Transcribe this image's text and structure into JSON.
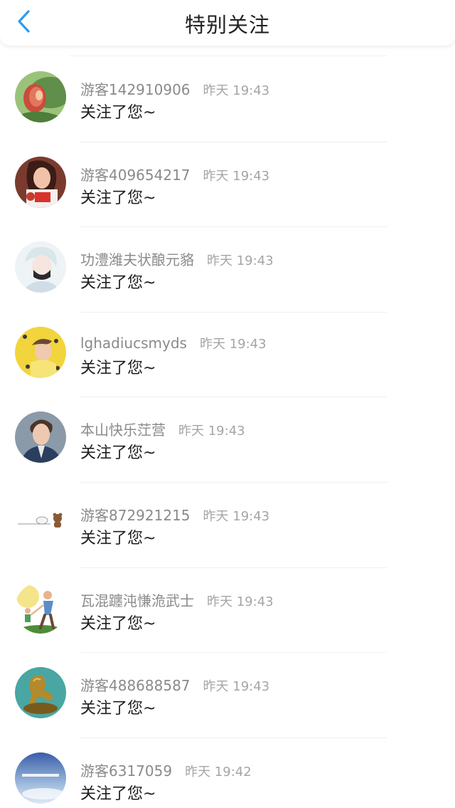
{
  "header": {
    "title": "特别关注",
    "back_icon": "chevron-left-icon",
    "accent_color": "#2f9bf0"
  },
  "items": [
    {
      "name": "游客142910906",
      "time": "昨天 19:43",
      "message": "关注了您~",
      "avatar": "cactus-flower"
    },
    {
      "name": "游客409654217",
      "time": "昨天 19:43",
      "message": "关注了您~",
      "avatar": "girl-red"
    },
    {
      "name": "功澧潍夫状酿元貉",
      "time": "昨天 19:43",
      "message": "关注了您~",
      "avatar": "anime-boy-mask"
    },
    {
      "name": "lghadiucsmyds",
      "time": "昨天 19:43",
      "message": "关注了您~",
      "avatar": "girl-yellow"
    },
    {
      "name": "本山快乐茳营",
      "time": "昨天 19:43",
      "message": "关注了您~",
      "avatar": "man-suit"
    },
    {
      "name": "游客872921215",
      "time": "昨天 19:43",
      "message": "关注了您~",
      "avatar": "bear-sticker"
    },
    {
      "name": "瓦混躔沌慊洈武士",
      "time": "昨天 19:43",
      "message": "关注了您~",
      "avatar": "father-child"
    },
    {
      "name": "游客488688587",
      "time": "昨天 19:43",
      "message": "关注了您~",
      "avatar": "golden-horse"
    },
    {
      "name": "游客6317059",
      "time": "昨天 19:42",
      "message": "关注了您~",
      "avatar": "sky"
    }
  ]
}
